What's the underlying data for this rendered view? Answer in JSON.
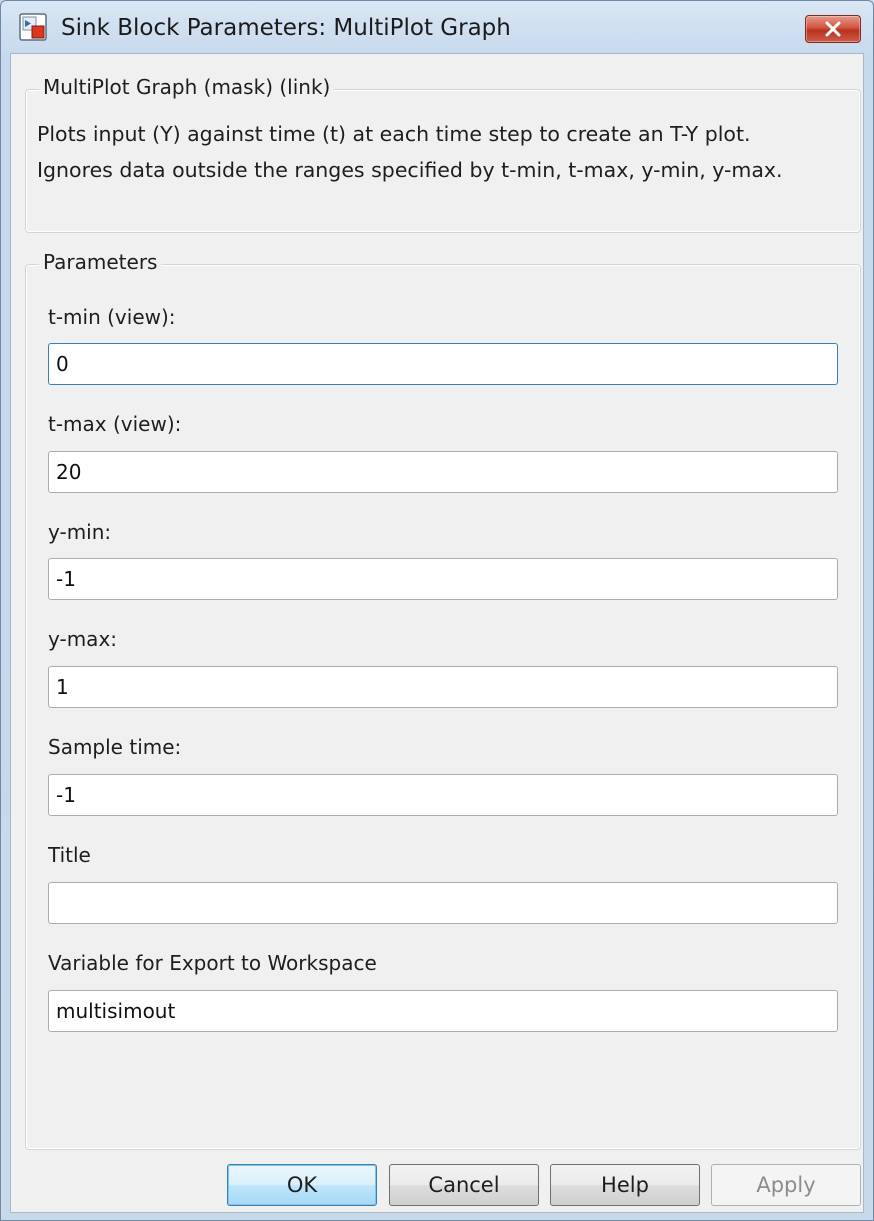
{
  "window": {
    "title": "Sink Block Parameters: MultiPlot Graph",
    "icon": "simulink-block-icon",
    "close_icon": "close-x-icon"
  },
  "mask": {
    "legend": "MultiPlot Graph (mask) (link)",
    "description": "Plots  input (Y) against time (t) at each time step to  create an T-Y plot. Ignores data outside the ranges specified by t-min, t-max, y-min, y-max."
  },
  "parameters": {
    "legend": "Parameters",
    "fields": [
      {
        "label": "t-min (view):",
        "value": "0"
      },
      {
        "label": "t-max (view):",
        "value": "20"
      },
      {
        "label": "y-min:",
        "value": "-1"
      },
      {
        "label": "y-max:",
        "value": "1"
      },
      {
        "label": "Sample time:",
        "value": "-1"
      },
      {
        "label": "Title",
        "value": ""
      },
      {
        "label": "Variable for Export to Workspace",
        "value": "multisimout"
      }
    ]
  },
  "buttons": {
    "ok": "OK",
    "cancel": "Cancel",
    "help": "Help",
    "apply": "Apply"
  },
  "colors": {
    "accent": "#3c7fb1",
    "close_button": "#c7432e",
    "dialog_background": "#f0f0f0"
  }
}
